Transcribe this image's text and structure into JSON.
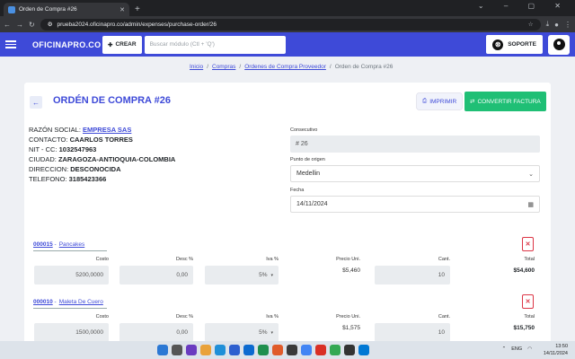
{
  "browser": {
    "tab_title": "Orden de Compra #26",
    "url": "prueba2024.oficinapro.co/admin/expenses/purchase-order/26"
  },
  "nav": {
    "brand": "OFICINAPRO.CO",
    "create_label": "CREAR",
    "search_placeholder": "Buscar módulo (Ctl + 'Q')",
    "support_label": "SOPORTE"
  },
  "breadcrumb": [
    "Inicio",
    "Compras",
    "Ordenes de Compra Proveedor",
    "Orden de Compra #26"
  ],
  "order": {
    "title": "ORDÉN DE COMPRA #26",
    "print_label": "IMPRIMIR",
    "convert_label": "CONVERTIR FACTURA",
    "supplier": {
      "razon_label": "RAZÓN SOCIAL:",
      "razon_value": "EMPRESA SAS",
      "contacto_label": "CONTACTO:",
      "contacto_value": "CAARLOS TORRES",
      "nit_label": "NIT - CC:",
      "nit_value": "1032547963",
      "ciudad_label": "CIUDAD:",
      "ciudad_value": "ZARAGOZA-ANTIOQUIA-COLOMBIA",
      "direccion_label": "DIRECCION:",
      "direccion_value": "DESCONOCIDA",
      "telefono_label": "TELEFONO:",
      "telefono_value": "3185423366"
    },
    "fields": {
      "consecutivo_label": "Consecutivo",
      "consecutivo_value": "# 26",
      "origen_label": "Punto de origen",
      "origen_value": "Medellin",
      "fecha_label": "Fecha",
      "fecha_value": "14/11/2024"
    }
  },
  "columns": {
    "costo": "Costo",
    "desc": "Desc %",
    "iva": "Iva %",
    "precio": "Precio Uni.",
    "cant": "Cant.",
    "total": "Total"
  },
  "items": [
    {
      "code": "000015",
      "name": "Pancakes",
      "costo": "5200,0000",
      "desc": "0,00",
      "iva": "5%",
      "precio": "$5,460",
      "cant": "10",
      "total": "$54,600"
    },
    {
      "code": "000010",
      "name": "Maleta De Cuero",
      "costo": "1500,0000",
      "desc": "0,00",
      "iva": "5%",
      "precio": "$1,575",
      "cant": "10",
      "total": "$15,750"
    }
  ],
  "taskbar": {
    "lang": "ENG",
    "time": "13:50",
    "date": "14/11/2024"
  },
  "colors": {
    "primary": "#3e4ad8",
    "success": "#1fbf75",
    "danger": "#dc3545"
  }
}
